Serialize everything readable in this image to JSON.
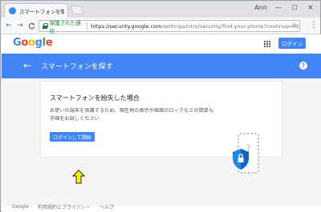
{
  "browser": {
    "tab_title": "スマートフォンを探す",
    "tab_close": "×",
    "window": {
      "profile": "Ann",
      "minimize": "—",
      "maximize": "☐",
      "close": "✕"
    },
    "nav": {
      "back": "←",
      "forward": "→",
      "reload": "C"
    },
    "security_label": "保護された通信",
    "url_host": "https://security.google.com",
    "url_path": "/settings/intro/security/find-your-phone?continue=https/...",
    "star": "☆",
    "menu": "⋮"
  },
  "header": {
    "logo": [
      "G",
      "o",
      "o",
      "g",
      "l",
      "e"
    ],
    "logo_colors": [
      "#4285f4",
      "#ea4335",
      "#fbbc05",
      "#4285f4",
      "#34a853",
      "#ea4335"
    ],
    "login_label": "ログイン"
  },
  "bluebar": {
    "back_icon": "←",
    "title": "スマートフォンを探す",
    "help_icon": "?"
  },
  "card": {
    "title": "スマートフォンを紛失した場合",
    "description": "お使いの端末を保護するため、現在地の表示や画面のロックなどの簡単な手順をお試しください",
    "button_label": "ログインして開始"
  },
  "footer": {
    "links": [
      "Google",
      "利用規約とプライバシー",
      "ヘルプ"
    ]
  },
  "colors": {
    "brand_blue": "#4285f4",
    "secure_green": "#188038",
    "cursor_yellow": "#fff200"
  }
}
